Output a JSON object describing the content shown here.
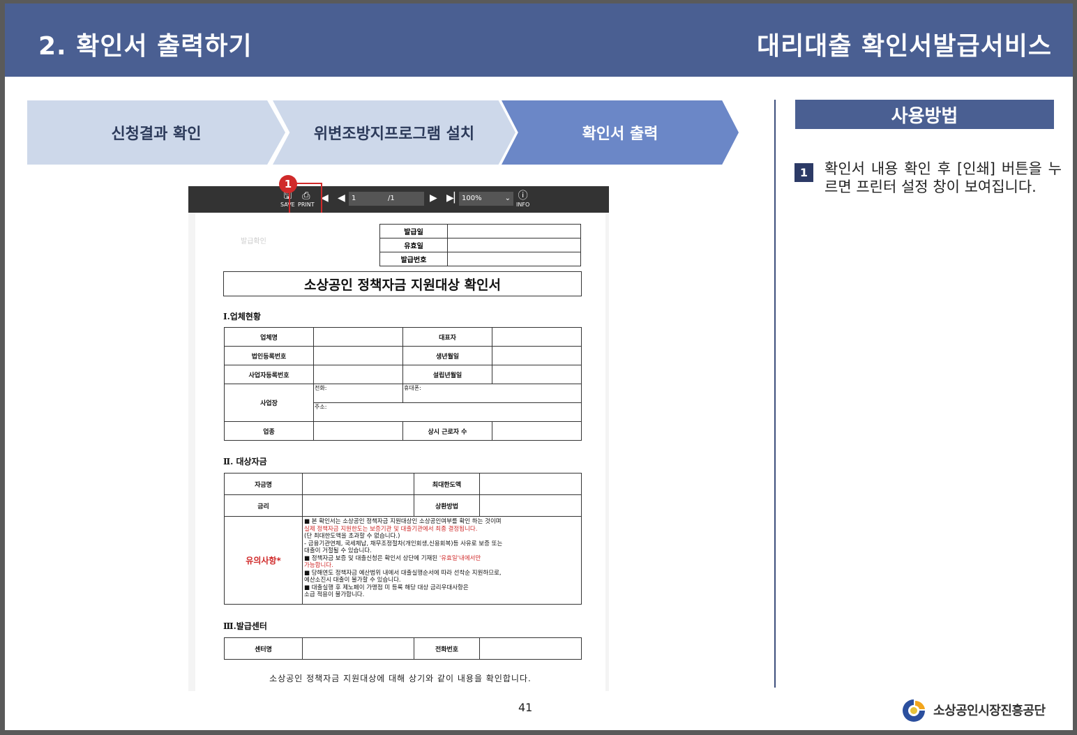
{
  "header": {
    "left_title": "2. 확인서 출력하기",
    "right_title": "대리대출 확인서발급서비스"
  },
  "steps": [
    "신청결과 확인",
    "위변조방지프로그램 설치",
    "확인서 출력"
  ],
  "howto": {
    "title": "사용방법",
    "step_number": "1",
    "instruction": "확인서 내용 확인 후 [인쇄] 버튼을 누르면 프린터 설정 창이 보여집니다."
  },
  "viewer": {
    "save_label": "SAVE",
    "print_label": "PRINT",
    "page_value": "1",
    "page_total": "/1",
    "zoom": "100%",
    "info_label": "INFO",
    "marker": "1"
  },
  "document": {
    "faint_text": "발급확인",
    "issue": {
      "date": "발급일",
      "valid": "유효일",
      "number": "발급번호"
    },
    "title": "소상공인 정책자금 지원대상 확인서",
    "sec1": "Ⅰ.업체현황",
    "company": {
      "name": "업체명",
      "rep": "대표자",
      "corp_no": "법인등록번호",
      "birth": "생년월일",
      "biz_no": "사업자등록번호",
      "est": "설립년월일",
      "place": "사업장",
      "phone": "전화:",
      "mobile": "휴대폰:",
      "address": "주소:",
      "industry": "업종",
      "workers": "상시 근로자 수"
    },
    "sec2": "Ⅱ. 대상자금",
    "fund": {
      "name": "자금명",
      "max": "최대한도액",
      "rate": "금리",
      "repay": "상환방법",
      "notice_label": "유의사항*",
      "n1": "■ 본 확인서는 소상공인 정책자금 지원대상인 소상공인여부를 확인 하는 것이며",
      "n2": "실제 정책자금 지원한도는 보증기관 및 대출기관에서 최종 결정됩니다.",
      "n3": "(단 최대한도액을 초과할 수 없습니다.)",
      "n4": "- 금융기관연체, 국세체납, 채무조정절차(개인회생,신용회복)등 사유로 보증 또는",
      "n5": "대출이 거절될 수 있습니다.",
      "n6": "■ 정책자금 보증 및 대출신청은 확인서 상단에 기재된 ",
      "n6r": "'유효일'내에서만",
      "n7": "가능합니다.",
      "n8": "■ 당해연도 정책자금 예산범위 내에서 대출실행순서에 따라 선착순 지원하므로,",
      "n9": "예산소진시 대출이 불가할 수 있습니다.",
      "n10": "■ 대출실행 후 제노페이 가맹점 미 등록 해당 대상 금리우대사항은",
      "n11": "소급 적용이 불가합니다."
    },
    "sec3": "Ⅲ.발급센터",
    "center": {
      "name": "센터명",
      "phone": "전화번호"
    },
    "confirm": "소상공인 정책자금 지원대상에 대해 상기와 같이 내용을 확인합니다."
  },
  "page_number": "41",
  "logo_text": "소상공인시장진흥공단"
}
